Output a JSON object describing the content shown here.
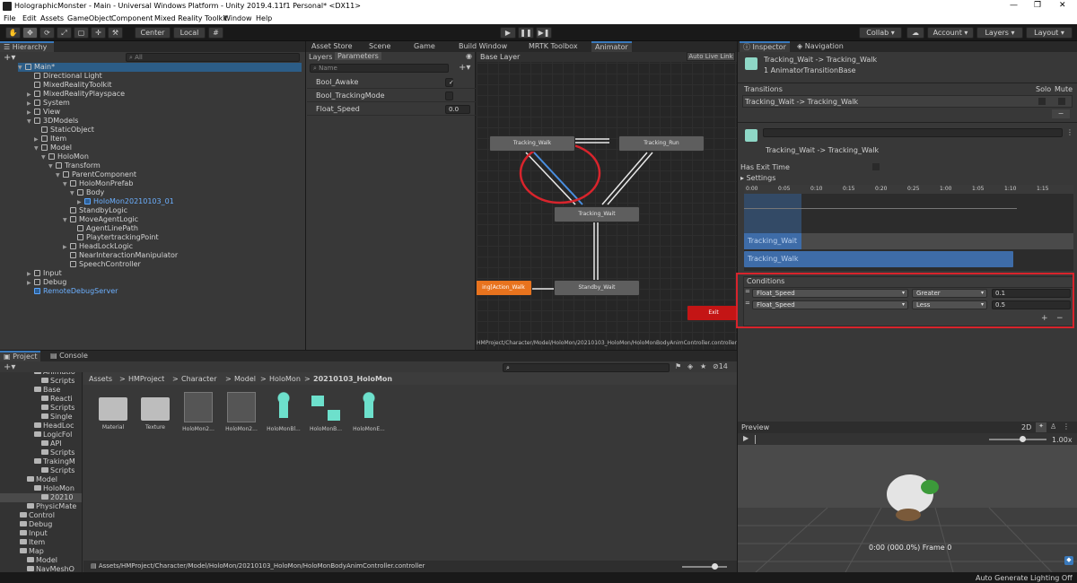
{
  "window": {
    "title": "HolographicMonster - Main - Universal Windows Platform - Unity 2019.4.11f1 Personal* <DX11>",
    "controls": [
      "—",
      "❐",
      "✕"
    ]
  },
  "menu": [
    "File",
    "Edit",
    "Assets",
    "GameObject",
    "Component",
    "Mixed Reality Toolkit",
    "Window",
    "Help"
  ],
  "toolbar": {
    "pivot": "Center",
    "space": "Local",
    "collab": "Collab",
    "account": "Account",
    "layers": "Layers",
    "layout": "Layout"
  },
  "hierarchy": {
    "tab": "Hierarchy",
    "search_placeholder": "All",
    "rows": [
      {
        "label": "Main*",
        "depth": 0,
        "arrow": "▼",
        "kind": "scene"
      },
      {
        "label": "Directional Light",
        "depth": 1,
        "arrow": "",
        "kind": "obj"
      },
      {
        "label": "MixedRealityToolkit",
        "depth": 1,
        "arrow": "",
        "kind": "obj"
      },
      {
        "label": "MixedRealityPlayspace",
        "depth": 1,
        "arrow": "▶",
        "kind": "obj"
      },
      {
        "label": "System",
        "depth": 1,
        "arrow": "▶",
        "kind": "obj"
      },
      {
        "label": "View",
        "depth": 1,
        "arrow": "▶",
        "kind": "obj"
      },
      {
        "label": "3DModels",
        "depth": 1,
        "arrow": "▼",
        "kind": "obj"
      },
      {
        "label": "StaticObject",
        "depth": 2,
        "arrow": "",
        "kind": "obj"
      },
      {
        "label": "Item",
        "depth": 2,
        "arrow": "▶",
        "kind": "obj"
      },
      {
        "label": "Model",
        "depth": 2,
        "arrow": "▼",
        "kind": "obj"
      },
      {
        "label": "HoloMon",
        "depth": 3,
        "arrow": "▼",
        "kind": "obj"
      },
      {
        "label": "Transform",
        "depth": 4,
        "arrow": "▼",
        "kind": "obj"
      },
      {
        "label": "ParentComponent",
        "depth": 5,
        "arrow": "▼",
        "kind": "obj"
      },
      {
        "label": "HoloMonPrefab",
        "depth": 6,
        "arrow": "▼",
        "kind": "obj"
      },
      {
        "label": "Body",
        "depth": 7,
        "arrow": "▼",
        "kind": "obj"
      },
      {
        "label": "HoloMon20210103_01",
        "depth": 8,
        "arrow": "▶",
        "kind": "prefab"
      },
      {
        "label": "StandbyLogic",
        "depth": 6,
        "arrow": "",
        "kind": "obj"
      },
      {
        "label": "MoveAgentLogic",
        "depth": 6,
        "arrow": "▼",
        "kind": "obj"
      },
      {
        "label": "AgentLinePath",
        "depth": 7,
        "arrow": "",
        "kind": "obj"
      },
      {
        "label": "PlaytertrackingPoint",
        "depth": 7,
        "arrow": "",
        "kind": "obj"
      },
      {
        "label": "HeadLockLogic",
        "depth": 6,
        "arrow": "▶",
        "kind": "obj"
      },
      {
        "label": "NearInteractionManipulator",
        "depth": 6,
        "arrow": "",
        "kind": "obj"
      },
      {
        "label": "SpeechController",
        "depth": 6,
        "arrow": "",
        "kind": "obj"
      },
      {
        "label": "Input",
        "depth": 1,
        "arrow": "▶",
        "kind": "obj"
      },
      {
        "label": "Debug",
        "depth": 1,
        "arrow": "▶",
        "kind": "obj"
      },
      {
        "label": "RemoteDebugServer",
        "depth": 1,
        "arrow": "",
        "kind": "prefab"
      }
    ]
  },
  "center_tabs": [
    "Asset Store",
    "Scene",
    "Game",
    "Build Window",
    "MRTK Toolbox",
    "Animator"
  ],
  "animator": {
    "sub_tabs": [
      "Layers",
      "Parameters"
    ],
    "search_placeholder": "Name",
    "layer": "Base Layer",
    "auto_live_link": "Auto Live Link",
    "parameters": [
      {
        "name": "Bool_Awake",
        "value": "✓"
      },
      {
        "name": "Bool_TrackingMode",
        "value": ""
      },
      {
        "name": "Float_Speed",
        "value": "0.0"
      }
    ],
    "states": {
      "walk": "Tracking_Walk",
      "run": "Tracking_Run",
      "wait": "Tracking_Wait",
      "standby": "Standby_Wait",
      "action": "ing[Action_Walk",
      "exit": "Exit"
    },
    "path": "HMProject/Character/Model/HoloMon/20210103_HoloMon/HoloMonBodyAnimController.controller"
  },
  "inspector": {
    "tabs": [
      "Inspector",
      "Navigation"
    ],
    "header_title": "Tracking_Wait -> Tracking_Walk",
    "header_sub": "1 AnimatorTransitionBase",
    "transitions_label": "Transitions",
    "solo": "Solo",
    "mute": "Mute",
    "transition_item": "Tracking_Wait -> Tracking_Walk",
    "transition_name": "Tracking_Wait -> Tracking_Walk",
    "has_exit_time": "Has Exit Time",
    "settings": "Settings",
    "timeline_ticks": [
      "0:00",
      "0:05",
      "0:10",
      "0:15",
      "0:20",
      "0:25",
      "1:00",
      "1:05",
      "1:10",
      "1:15"
    ],
    "track_wait": "Tracking_Wait",
    "track_walk": "Tracking_Walk",
    "conditions_label": "Conditions",
    "conditions": [
      {
        "param": "Float_Speed",
        "mode": "Greater",
        "value": "0.1"
      },
      {
        "param": "Float_Speed",
        "mode": "Less",
        "value": "0.5"
      }
    ],
    "preview": "Preview",
    "preview_2d": "2D",
    "preview_speed": "1.00x",
    "preview_time": "0:00 (000.0%) Frame 0"
  },
  "project": {
    "tabs": [
      "Project",
      "Console"
    ],
    "breadcrumb": [
      "Assets",
      "HMProject",
      "Character",
      "Model",
      "HoloMon",
      "20210103_HoloMon"
    ],
    "count": "14",
    "tree": [
      {
        "label": "Animatio",
        "indent": 2
      },
      {
        "label": "Scripts",
        "indent": 3
      },
      {
        "label": "Base",
        "indent": 2
      },
      {
        "label": "Reacti",
        "indent": 3
      },
      {
        "label": "Scripts",
        "indent": 3
      },
      {
        "label": "Single",
        "indent": 3
      },
      {
        "label": "HeadLoc",
        "indent": 2
      },
      {
        "label": "LogicFol",
        "indent": 2
      },
      {
        "label": "API",
        "indent": 3
      },
      {
        "label": "Scripts",
        "indent": 3
      },
      {
        "label": "TrakingM",
        "indent": 2
      },
      {
        "label": "Scripts",
        "indent": 3
      },
      {
        "label": "Model",
        "indent": 1
      },
      {
        "label": "HoloMon",
        "indent": 2
      },
      {
        "label": "20210",
        "indent": 3
      },
      {
        "label": "PhysicMate",
        "indent": 1
      },
      {
        "label": "Control",
        "indent": 0
      },
      {
        "label": "Debug",
        "indent": 0
      },
      {
        "label": "Input",
        "indent": 0
      },
      {
        "label": "Item",
        "indent": 0
      },
      {
        "label": "Map",
        "indent": 0
      },
      {
        "label": "Model",
        "indent": 1
      },
      {
        "label": "NavMeshO",
        "indent": 1
      }
    ],
    "assets": [
      "Material",
      "Texture",
      "HoloMon2...",
      "HoloMon2...",
      "HoloMonBl...",
      "HoloMonB...",
      "HoloMonE..."
    ],
    "selected_path": "Assets/HMProject/Character/Model/HoloMon/20210103_HoloMon/HoloMonBodyAnimController.controller"
  },
  "status": "Auto Generate Lighting Off",
  "colors": {
    "accent": "#3a79bb",
    "highlight_red": "#d8242c",
    "orange_state": "#e8731e",
    "exit_state": "#c41515"
  }
}
